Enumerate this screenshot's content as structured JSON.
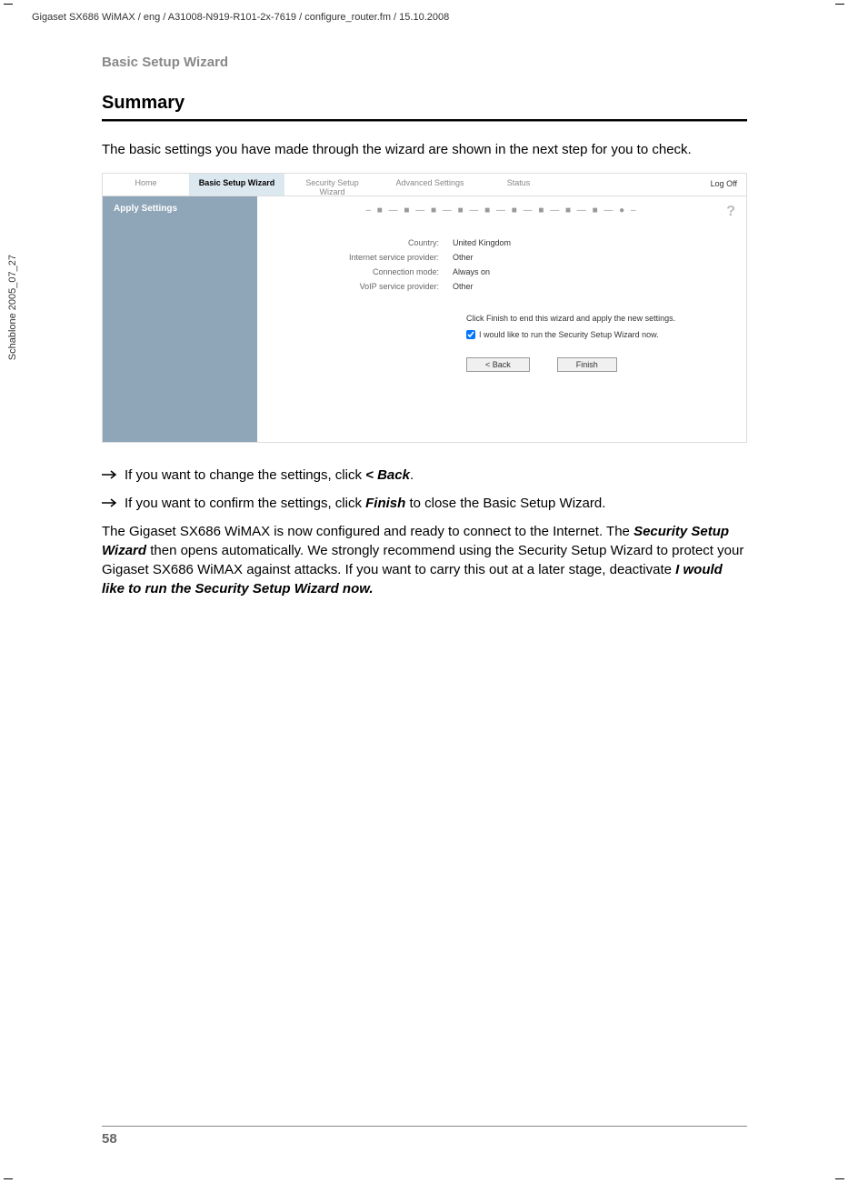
{
  "header": "Gigaset SX686 WiMAX / eng / A31008-N919-R101-2x-7619 / configure_router.fm / 15.10.2008",
  "vertical": "Schablone 2005_07_27",
  "section_label": "Basic Setup Wizard",
  "page_title": "Summary",
  "intro": "The basic settings you have made through the wizard are shown in the next step for you to check.",
  "router": {
    "tabs": {
      "home": "Home",
      "basic": "Basic Setup Wizard",
      "security": "Security Setup Wizard",
      "advanced": "Advanced Settings",
      "status": "Status"
    },
    "logoff": "Log Off",
    "sidebar": "Apply Settings",
    "help": "?",
    "progress": "– ■ — ■ — ■ — ■ — ■ — ■ — ■ — ■ — ■ — ● –",
    "settings": {
      "country_label": "Country:",
      "country_value": "United Kingdom",
      "isp_label": "Internet service provider:",
      "isp_value": "Other",
      "conn_label": "Connection mode:",
      "conn_value": "Always on",
      "voip_label": "VoIP service provider:",
      "voip_value": "Other"
    },
    "finish_text": "Click Finish to end this wizard and apply the new settings.",
    "checkbox_text": "I would like to run the Security Setup Wizard now.",
    "back_btn": "< Back",
    "finish_btn": "Finish"
  },
  "bullets": {
    "b1_pre": "If you want to change the settings, click ",
    "b1_bold": "< Back",
    "b1_post": ".",
    "b2_pre": "If you want to confirm the settings, click ",
    "b2_bold": "Finish",
    "b2_post": " to close the Basic Setup Wizard."
  },
  "para": {
    "p1": "The Gigaset SX686 WiMAX is now configured and ready to connect to the Internet. The ",
    "p2_bold": "Security Setup Wizard",
    "p3": " then opens automatically. We strongly recommend using the Security Setup Wizard to protect your Gigaset SX686 WiMAX against attacks. If you want to carry this out at a later stage, deactivate ",
    "p4_bold": "I would like to run the Security Setup Wizard now.",
    "p5": ""
  },
  "page_num": "58"
}
